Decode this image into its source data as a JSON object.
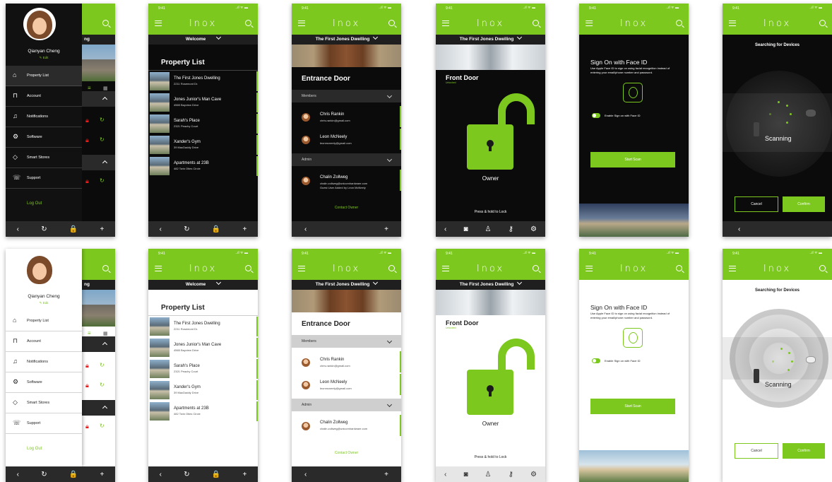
{
  "app": {
    "logo": "Inox",
    "status_time": "9:41",
    "status_icons": "..ıl ᯤ ▬"
  },
  "drawer": {
    "user_name": "Qianyan Cheng",
    "edit_label": "Edit",
    "items": [
      {
        "icon": "home-icon",
        "glyph": "⌂",
        "label": "Property List"
      },
      {
        "icon": "bookmark-icon",
        "glyph": "⊓",
        "label": "Account"
      },
      {
        "icon": "bell-icon",
        "glyph": "♫",
        "label": "Notifications"
      },
      {
        "icon": "gear-icon",
        "glyph": "⚙",
        "label": "Software"
      },
      {
        "icon": "tag-icon",
        "glyph": "◇",
        "label": "Smart Stores"
      },
      {
        "icon": "phone-icon",
        "glyph": "☏",
        "label": "Support"
      }
    ],
    "logout_label": "Log Out",
    "peek_text": "ng"
  },
  "property": {
    "welcome": "Welcome",
    "title": "Property List",
    "items": [
      {
        "name": "The First Jones Dwelling",
        "address": "2211 Rosemont Dr."
      },
      {
        "name": "Jones Junior's Man Cave",
        "address": "4565 Bayview Drive"
      },
      {
        "name": "Sarah's Place",
        "address": "2321 Peachy Court"
      },
      {
        "name": "Xander's Gym",
        "address": "39 MacDaddy Drive"
      },
      {
        "name": "Apartments at 23B",
        "address": "482 Twin Oties Circle"
      }
    ]
  },
  "door": {
    "dwelling": "The First Jones Dwelling",
    "title": "Entrance Door",
    "members_label": "Members",
    "members": [
      {
        "name": "Chris Rankin",
        "email": "chris.rankin@gmail.com"
      },
      {
        "name": "Leon McNeely",
        "email": "leonmcneely@gmail.com"
      }
    ],
    "admin_label": "Admin",
    "admin": {
      "name": "Chalin Zollweg",
      "email": "chalin.zollweg@unicomhardware.com",
      "note": "Guest User Added by Leon McNeely"
    },
    "contact_label": "Contact Owner"
  },
  "front": {
    "title": "Front Door",
    "state": "Unlocked",
    "role": "Owner",
    "hint": "Press & hold to Lock"
  },
  "faceid": {
    "title": "Sign On with Face ID",
    "desc": "Use Apple Face ID to sign on using facial recognition instead of entering your email/phone number and password.",
    "toggle_label": "Enable Sign on with Face ID",
    "button": "Start Scan"
  },
  "search": {
    "title": "Searching for Devices",
    "scanning": "Scanning",
    "cancel": "Cancel",
    "confirm": "Confirm"
  },
  "nav": {
    "back": "‹",
    "sync": "↻",
    "lock": "🔒",
    "add": "+",
    "scan": "◙",
    "user": "♙",
    "key": "⚷",
    "gear": "⚙"
  },
  "colors": {
    "accent": "#7cc81e",
    "dark_bg": "#0b0b0b",
    "danger": "#e02020"
  }
}
